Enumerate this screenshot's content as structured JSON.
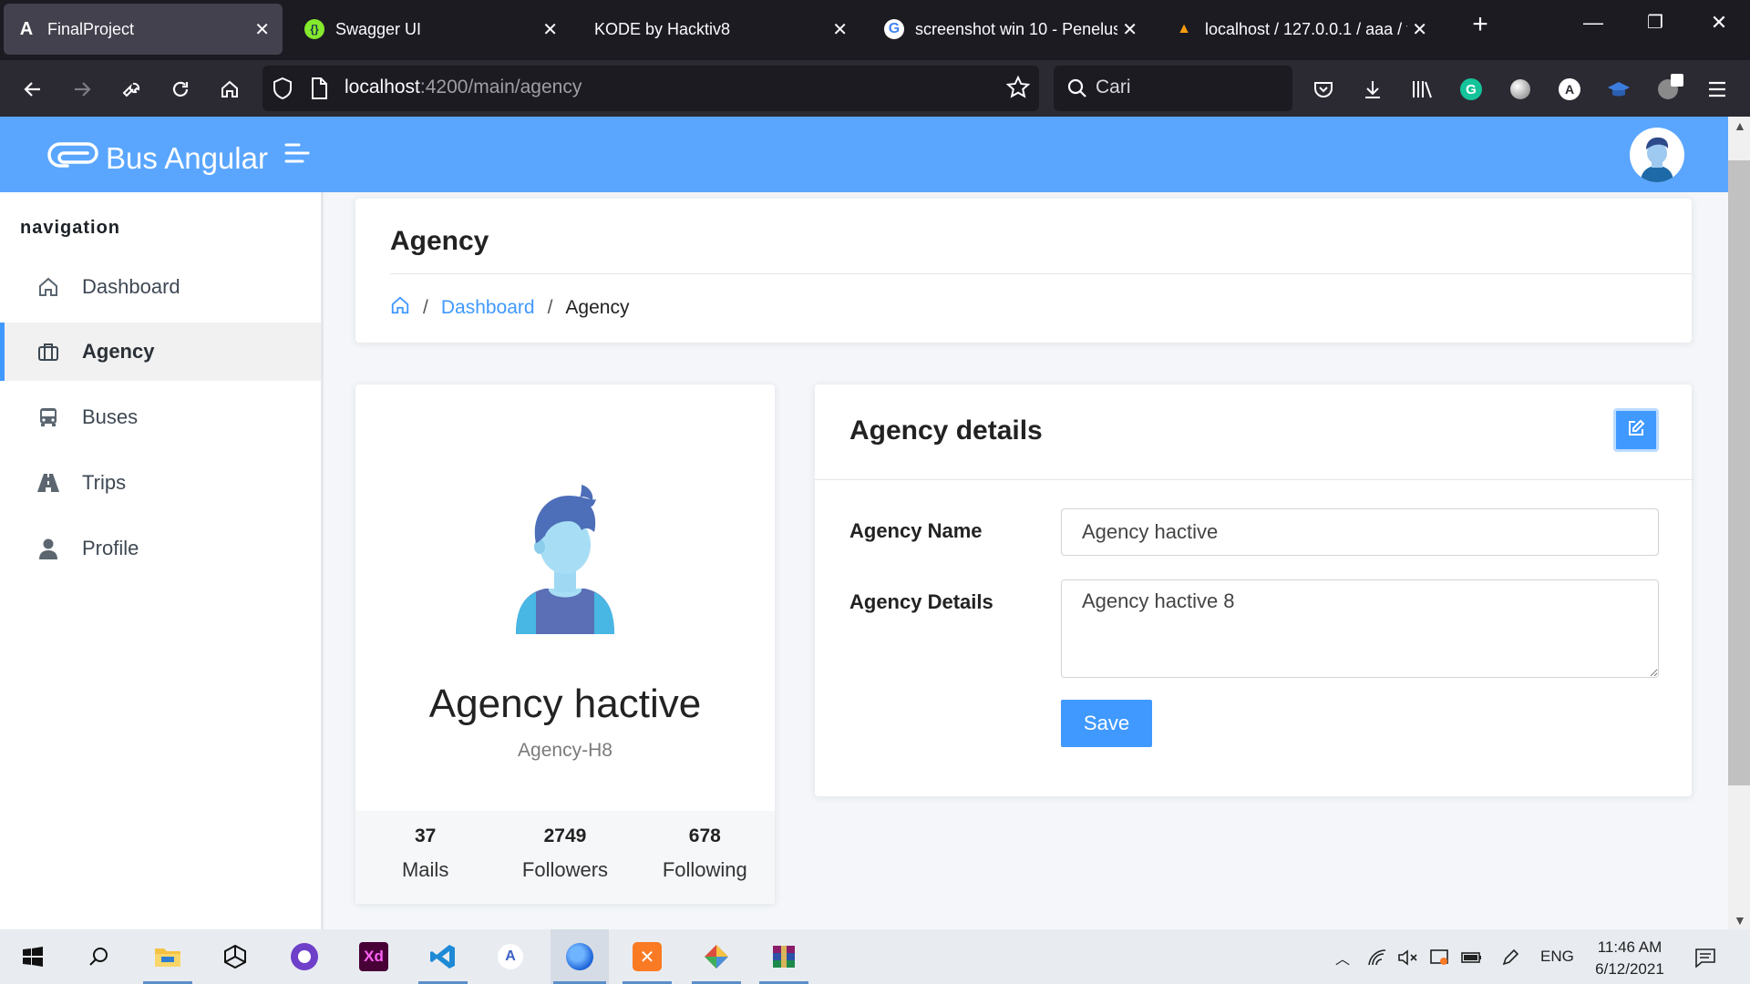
{
  "browser": {
    "tabs": [
      {
        "label": "FinalProject",
        "active": true
      },
      {
        "label": "Swagger UI",
        "active": false
      },
      {
        "label": "KODE by Hacktiv8",
        "active": false
      },
      {
        "label": "screenshot win 10 - Penelusu",
        "active": false
      },
      {
        "label": "localhost / 127.0.0.1 / aaa / tr",
        "active": false
      }
    ],
    "url_host": "localhost",
    "url_path": ":4200/main/agency",
    "search_placeholder": "Cari"
  },
  "app": {
    "brand": "Bus Angular",
    "accent_color": "#5aa6ff",
    "primary_color": "#4099ff"
  },
  "sidebar": {
    "caption": "navigation",
    "items": [
      {
        "label": "Dashboard",
        "icon": "home-icon",
        "active": false
      },
      {
        "label": "Agency",
        "icon": "briefcase-icon",
        "active": true
      },
      {
        "label": "Buses",
        "icon": "bus-icon",
        "active": false
      },
      {
        "label": "Trips",
        "icon": "road-icon",
        "active": false
      },
      {
        "label": "Profile",
        "icon": "user-icon",
        "active": false
      }
    ]
  },
  "page_header": {
    "title": "Agency",
    "breadcrumb": {
      "link": "Dashboard",
      "current": "Agency"
    }
  },
  "profile_card": {
    "name": "Agency hactive",
    "subtitle": "Agency-H8",
    "stats": [
      {
        "value": "37",
        "label": "Mails"
      },
      {
        "value": "2749",
        "label": "Followers"
      },
      {
        "value": "678",
        "label": "Following"
      }
    ]
  },
  "details_card": {
    "title": "Agency details",
    "name_label": "Agency Name",
    "name_value": "Agency hactive",
    "details_label": "Agency Details",
    "details_value": "Agency hactive 8",
    "save_label": "Save"
  },
  "taskbar": {
    "language": "ENG",
    "time": "11:46 AM",
    "date": "6/12/2021"
  }
}
